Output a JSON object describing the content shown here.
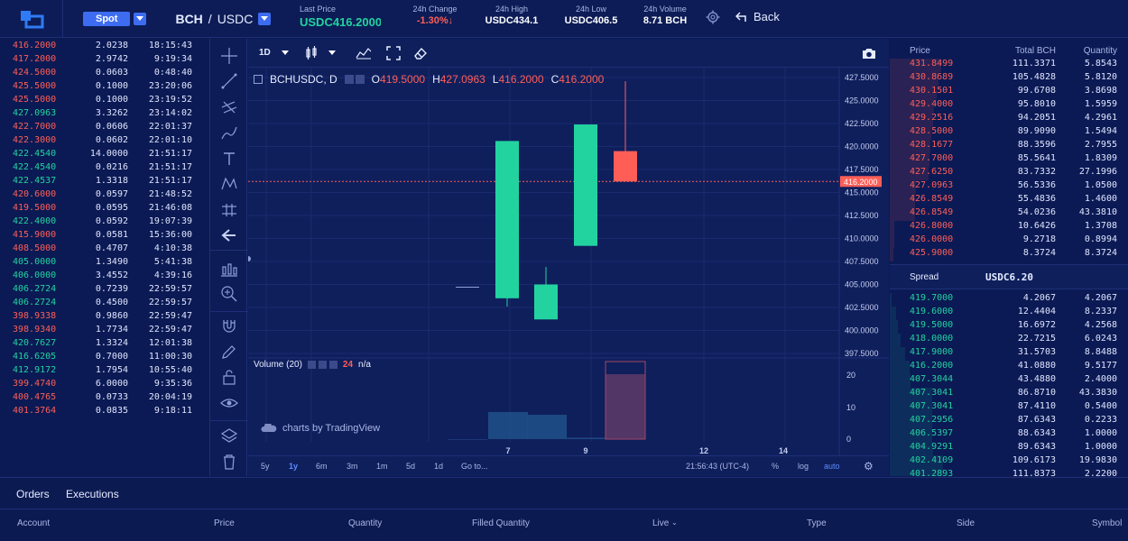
{
  "header": {
    "market_type": "Spot",
    "pair_base": "BCH",
    "pair_quote": "USDC",
    "pair_sep": "/",
    "stats": [
      {
        "label": "Last Price",
        "value": "USDC416.2000",
        "color": "#22d3a0"
      },
      {
        "label": "24h Change",
        "value": "-1.30%↓",
        "color": "#ff5e57"
      },
      {
        "label": "24h High",
        "value": "USDC434.1",
        "color": "#ffffff"
      },
      {
        "label": "24h Low",
        "value": "USDC406.5",
        "color": "#ffffff"
      },
      {
        "label": "24h Volume",
        "value": "8.71 BCH",
        "color": "#ffffff"
      }
    ],
    "back_label": "Back"
  },
  "trades": [
    {
      "price": "416.2000",
      "qty": "2.0238",
      "time": "18:15:43",
      "side": "sell"
    },
    {
      "price": "417.2000",
      "qty": "2.9742",
      "time": "9:19:34",
      "side": "sell"
    },
    {
      "price": "424.5000",
      "qty": "0.0603",
      "time": "0:48:40",
      "side": "sell"
    },
    {
      "price": "425.5000",
      "qty": "0.1000",
      "time": "23:20:06",
      "side": "sell"
    },
    {
      "price": "425.5000",
      "qty": "0.1000",
      "time": "23:19:52",
      "side": "sell"
    },
    {
      "price": "427.0963",
      "qty": "3.3262",
      "time": "23:14:02",
      "side": "buy"
    },
    {
      "price": "422.7000",
      "qty": "0.0606",
      "time": "22:01:37",
      "side": "sell"
    },
    {
      "price": "422.3000",
      "qty": "0.0602",
      "time": "22:01:10",
      "side": "sell"
    },
    {
      "price": "422.4540",
      "qty": "14.0000",
      "time": "21:51:17",
      "side": "buy"
    },
    {
      "price": "422.4540",
      "qty": "0.0216",
      "time": "21:51:17",
      "side": "buy"
    },
    {
      "price": "422.4537",
      "qty": "1.3318",
      "time": "21:51:17",
      "side": "buy"
    },
    {
      "price": "420.6000",
      "qty": "0.0597",
      "time": "21:48:52",
      "side": "sell"
    },
    {
      "price": "419.5000",
      "qty": "0.0595",
      "time": "21:46:08",
      "side": "sell"
    },
    {
      "price": "422.4000",
      "qty": "0.0592",
      "time": "19:07:39",
      "side": "buy"
    },
    {
      "price": "415.9000",
      "qty": "0.0581",
      "time": "15:36:00",
      "side": "sell"
    },
    {
      "price": "408.5000",
      "qty": "0.4707",
      "time": "4:10:38",
      "side": "sell"
    },
    {
      "price": "405.0000",
      "qty": "1.3490",
      "time": "5:41:38",
      "side": "buy"
    },
    {
      "price": "406.0000",
      "qty": "3.4552",
      "time": "4:39:16",
      "side": "buy"
    },
    {
      "price": "406.2724",
      "qty": "0.7239",
      "time": "22:59:57",
      "side": "buy"
    },
    {
      "price": "406.2724",
      "qty": "0.4500",
      "time": "22:59:57",
      "side": "buy"
    },
    {
      "price": "398.9338",
      "qty": "0.9860",
      "time": "22:59:47",
      "side": "sell"
    },
    {
      "price": "398.9340",
      "qty": "1.7734",
      "time": "22:59:47",
      "side": "sell"
    },
    {
      "price": "420.7627",
      "qty": "1.3324",
      "time": "12:01:38",
      "side": "buy"
    },
    {
      "price": "416.6205",
      "qty": "0.7000",
      "time": "11:00:30",
      "side": "buy"
    },
    {
      "price": "412.9172",
      "qty": "1.7954",
      "time": "10:55:40",
      "side": "buy"
    },
    {
      "price": "399.4740",
      "qty": "6.0000",
      "time": "9:35:36",
      "side": "sell"
    },
    {
      "price": "400.4765",
      "qty": "0.0733",
      "time": "20:04:19",
      "side": "sell"
    },
    {
      "price": "401.3764",
      "qty": "0.0835",
      "time": "9:18:11",
      "side": "sell"
    }
  ],
  "chart": {
    "interval": "1D",
    "symbol": "BCHUSDC, D",
    "o_label": "O",
    "o_value": "419.5000",
    "h_label": "H",
    "h_value": "427.0963",
    "l_label": "L",
    "l_value": "416.2000",
    "c_label": "C",
    "c_value": "416.2000",
    "volume_label": "Volume (20)",
    "volume_value": "24",
    "volume_na": "n/a",
    "watermark": "charts by TradingView",
    "timeframes": [
      "5y",
      "1y",
      "6m",
      "3m",
      "1m",
      "5d",
      "1d",
      "Go to..."
    ],
    "active_timeframe": "1y",
    "clock": "21:56:43 (UTC-4)",
    "opts": [
      "%",
      "log",
      "auto"
    ],
    "price_ticks": [
      "427.5000",
      "425.0000",
      "422.5000",
      "420.0000",
      "417.5000",
      "415.0000",
      "412.5000",
      "410.0000",
      "407.5000",
      "405.0000",
      "402.5000",
      "400.0000",
      "397.5000"
    ],
    "last_price_tag": "416.2000",
    "vol_ticks": [
      "20",
      "10",
      "0"
    ],
    "x_ticks": [
      "7",
      "9",
      "12",
      "14"
    ]
  },
  "chart_data": {
    "type": "candlestick",
    "y_range": [
      397.5,
      427.5
    ],
    "candles": [
      {
        "o": 404.7,
        "h": 404.7,
        "l": 404.7,
        "c": 404.7,
        "vol": 0
      },
      {
        "o": 403.5,
        "h": 420.6,
        "l": 402.6,
        "c": 420.6,
        "vol": 10
      },
      {
        "o": 401.2,
        "h": 406.9,
        "l": 401.2,
        "c": 405.0,
        "vol": 9
      },
      {
        "o": 409.2,
        "h": 422.4,
        "l": 409.2,
        "c": 422.4,
        "vol": 0.5
      },
      {
        "o": 419.5,
        "h": 427.1,
        "l": 416.2,
        "c": 416.2,
        "vol": 24
      }
    ]
  },
  "book": {
    "headers": [
      "Price",
      "Total BCH",
      "Quantity"
    ],
    "asks": [
      {
        "price": "431.8499",
        "total": "111.3371",
        "qty": "5.8543",
        "depth": 0.95
      },
      {
        "price": "430.8689",
        "total": "105.4828",
        "qty": "5.8120",
        "depth": 0.9
      },
      {
        "price": "430.1501",
        "total": "99.6708",
        "qty": "3.8698",
        "depth": 0.86
      },
      {
        "price": "429.4000",
        "total": "95.8010",
        "qty": "1.5959",
        "depth": 0.82
      },
      {
        "price": "429.2516",
        "total": "94.2051",
        "qty": "4.2961",
        "depth": 0.8
      },
      {
        "price": "428.5000",
        "total": "89.9090",
        "qty": "1.5494",
        "depth": 0.77
      },
      {
        "price": "428.1677",
        "total": "88.3596",
        "qty": "2.7955",
        "depth": 0.75
      },
      {
        "price": "427.7000",
        "total": "85.5641",
        "qty": "1.8309",
        "depth": 0.73
      },
      {
        "price": "427.6250",
        "total": "83.7332",
        "qty": "27.1996",
        "depth": 0.72
      },
      {
        "price": "427.0963",
        "total": "56.5336",
        "qty": "1.0500",
        "depth": 0.48
      },
      {
        "price": "426.8549",
        "total": "55.4836",
        "qty": "1.4600",
        "depth": 0.47
      },
      {
        "price": "426.8549",
        "total": "54.0236",
        "qty": "43.3810",
        "depth": 0.46
      },
      {
        "price": "426.8000",
        "total": "10.6426",
        "qty": "1.3708",
        "depth": 0.09
      },
      {
        "price": "426.0000",
        "total": "9.2718",
        "qty": "0.8994",
        "depth": 0.08
      },
      {
        "price": "425.9000",
        "total": "8.3724",
        "qty": "8.3724",
        "depth": 0.07
      }
    ],
    "spread_label": "Spread",
    "spread_value": "USDC6.20",
    "bids": [
      {
        "price": "419.7000",
        "total": "4.2067",
        "qty": "4.2067",
        "depth": 0.04
      },
      {
        "price": "419.6000",
        "total": "12.4404",
        "qty": "8.2337",
        "depth": 0.11
      },
      {
        "price": "419.5000",
        "total": "16.6972",
        "qty": "4.2568",
        "depth": 0.15
      },
      {
        "price": "418.0000",
        "total": "22.7215",
        "qty": "6.0243",
        "depth": 0.2
      },
      {
        "price": "417.9000",
        "total": "31.5703",
        "qty": "8.8488",
        "depth": 0.28
      },
      {
        "price": "416.2000",
        "total": "41.0880",
        "qty": "9.5177",
        "depth": 0.37
      },
      {
        "price": "407.3044",
        "total": "43.4880",
        "qty": "2.4000",
        "depth": 0.39
      },
      {
        "price": "407.3041",
        "total": "86.8710",
        "qty": "43.3830",
        "depth": 0.78
      },
      {
        "price": "407.3041",
        "total": "87.4110",
        "qty": "0.5400",
        "depth": 0.78
      },
      {
        "price": "407.2956",
        "total": "87.6343",
        "qty": "0.2233",
        "depth": 0.79
      },
      {
        "price": "406.5397",
        "total": "88.6343",
        "qty": "1.0000",
        "depth": 0.79
      },
      {
        "price": "404.9291",
        "total": "89.6343",
        "qty": "1.0000",
        "depth": 0.8
      },
      {
        "price": "402.4109",
        "total": "109.6173",
        "qty": "19.9830",
        "depth": 0.98
      },
      {
        "price": "401.2893",
        "total": "111.8373",
        "qty": "2.2200",
        "depth": 1.0
      }
    ]
  },
  "bottom": {
    "tabs": [
      "Orders",
      "Executions"
    ],
    "columns": [
      "Account",
      "Price",
      "Quantity",
      "Filled Quantity",
      "Live",
      "Type",
      "Side",
      "Symbol"
    ]
  },
  "colors": {
    "up": "#22d3a0",
    "down": "#ff5e57",
    "accent": "#3d6cf0"
  }
}
